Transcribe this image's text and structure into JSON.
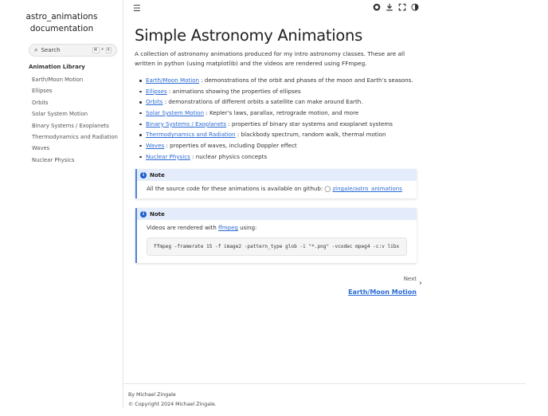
{
  "sidebar": {
    "brand_line1": "astro_animations",
    "brand_line2": "documentation",
    "search_placeholder": "Search",
    "shortcut": [
      "⌘",
      "+",
      "K"
    ],
    "caption": "Animation Library",
    "items": [
      "Earth/Moon Motion",
      "Ellipses",
      "Orbits",
      "Solar System Motion",
      "Binary Systems / Exoplanets",
      "Thermodynamics and Radiation",
      "Waves",
      "Nuclear Physics"
    ]
  },
  "header": {
    "icons": [
      "menu-icon",
      "github-icon",
      "download-icon",
      "fullscreen-icon",
      "theme-toggle-icon"
    ]
  },
  "main": {
    "title": "Simple Astronomy Animations",
    "intro": "A collection of astronomy animations produced for my intro astronomy classes. These are all written in python (using matplotlib) and the videos are rendered using FFmpeg.",
    "list": [
      {
        "link": "Earth/Moon Motion",
        "desc": " : demonstrations of the orbit and phases of the moon and Earth’s seasons."
      },
      {
        "link": "Ellipses",
        "desc": " : animations showing the properties of ellipses"
      },
      {
        "link": "Orbits",
        "desc": " : demonstrations of different orbits a satellite can make around Earth."
      },
      {
        "link": "Solar System Motion",
        "desc": " : Kepler’s laws, parallax, retrograde motion, and more"
      },
      {
        "link": "Binary Systems / Exoplanets",
        "desc": " : properties of binary star systems and exoplanet systems"
      },
      {
        "link": "Thermodynamics and Radiation",
        "desc": " : blackbody spectrum, random walk, thermal motion"
      },
      {
        "link": "Waves",
        "desc": " : properties of waves, including Doppler effect"
      },
      {
        "link": "Nuclear Physics",
        "desc": " : nuclear physics concepts"
      }
    ],
    "note1": {
      "title": "Note",
      "text": "All the source code for these animations is available on github: ",
      "link": "zingale/astro_animations"
    },
    "note2": {
      "title": "Note",
      "text_before": "Videos are rendered with ",
      "link": "ffmpeg",
      "text_after": " using:",
      "code": "ffmpeg -framerate 15 -f image2 -pattern_type glob -i \"*.png\" -vcodec mpeg4 -c:v libx"
    },
    "next": {
      "label": "Next",
      "title": "Earth/Moon Motion"
    }
  },
  "footer": {
    "author": "By Michael Zingale",
    "copyright": "© Copyright 2024 Michael Zingale."
  }
}
